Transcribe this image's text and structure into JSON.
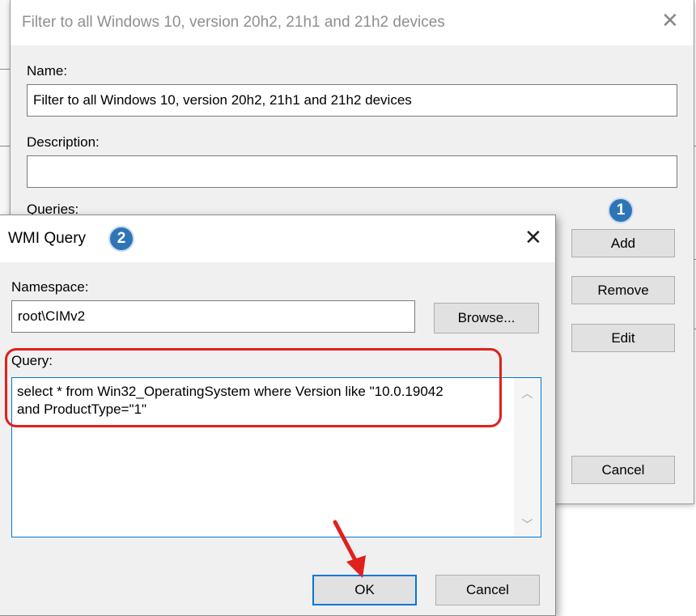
{
  "filter_dialog": {
    "title": "Filter to all Windows 10, version 20h2, 21h1 and 21h2 devices",
    "name_label": "Name:",
    "name_value": "Filter to all Windows 10, version 20h2, 21h1 and 21h2 devices",
    "description_label": "Description:",
    "description_value": "",
    "queries_label": "Queries:",
    "add_label": "Add",
    "remove_label": "Remove",
    "edit_label": "Edit",
    "cancel_label": "Cancel",
    "step_badge": "1"
  },
  "wmi_dialog": {
    "title": "WMI Query",
    "step_badge": "2",
    "namespace_label": "Namespace:",
    "namespace_value": "root\\CIMv2",
    "browse_label": "Browse...",
    "query_label": "Query:",
    "query_line1": "select * from Win32_OperatingSystem where Version like \"10.0.19042",
    "query_line2": "and ProductType=\"1\"",
    "ok_label": "OK",
    "cancel_label": "Cancel"
  },
  "icons": {
    "close": "close-icon",
    "scroll_up": "chevron-up-icon",
    "scroll_down": "chevron-down-icon",
    "annotation_arrow": "arrow-icon"
  },
  "colors": {
    "accent_blue": "#0078d7",
    "badge_blue": "#2e75b6",
    "highlight_red": "#e0201c"
  }
}
